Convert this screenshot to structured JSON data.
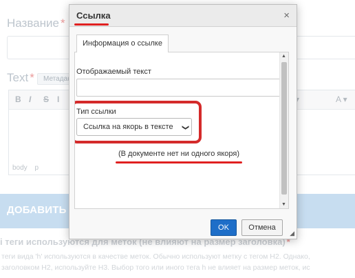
{
  "background": {
    "title_label": "Название",
    "required_mark": "*",
    "text_label": "Text",
    "meta_tag": "Метадан",
    "editor_status": [
      "body",
      "p"
    ],
    "add_button": "ДОБАВИТЬ П",
    "heading_text": "і теги используются для меток (не влияют на размер заголовка)",
    "heading_required": "*",
    "paragraph_line1": "теги вида 'h' используются в качестве меток. Обычно используют метку с тегом H2. Однако,",
    "paragraph_line2": "заголовком H2, используйте H3. Выбор того или иного тега h не влияет на размер меток, ис"
  },
  "dialog": {
    "title": "Ссылка",
    "close_glyph": "×",
    "tab_label": "Информация о ссылке",
    "display_text_label": "Отображаемый текст",
    "display_text_value": "",
    "link_type_label": "Тип ссылки",
    "link_type_selected": "Ссылка на якорь в тексте",
    "no_anchor_message": "(В документе нет ни одного якоря)",
    "ok_button": "OK",
    "cancel_button": "Отмена"
  },
  "icons": {
    "close": "close-icon",
    "dropdown": "chevron-down-icon",
    "resize": "resize-handle-icon"
  },
  "colors": {
    "annotation_red": "#d42a2a",
    "ok_blue": "#1e6ec8",
    "banner_blue": "#a9cbe8"
  }
}
